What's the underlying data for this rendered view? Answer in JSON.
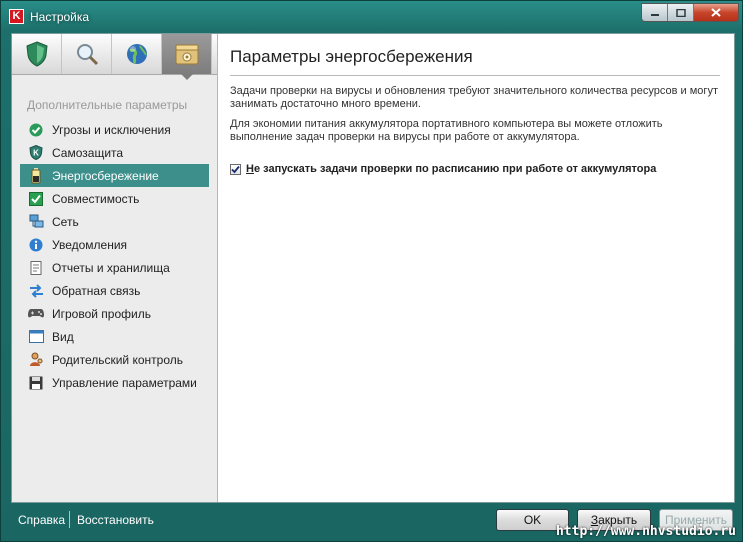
{
  "window": {
    "title": "Настройка"
  },
  "tabs": [
    {
      "icon": "shield-icon",
      "active": false
    },
    {
      "icon": "magnifier-icon",
      "active": false
    },
    {
      "icon": "globe-icon",
      "active": false
    },
    {
      "icon": "settings-box-icon",
      "active": true
    }
  ],
  "sidebar": {
    "heading": "Дополнительные параметры",
    "items": [
      {
        "label": "Угрозы и исключения",
        "icon": "check-circle-icon"
      },
      {
        "label": "Самозащита",
        "icon": "shield-k-icon"
      },
      {
        "label": "Энергосбережение",
        "icon": "battery-icon",
        "active": true
      },
      {
        "label": "Совместимость",
        "icon": "compatibility-icon"
      },
      {
        "label": "Сеть",
        "icon": "network-icon"
      },
      {
        "label": "Уведомления",
        "icon": "info-icon"
      },
      {
        "label": "Отчеты и хранилища",
        "icon": "reports-icon"
      },
      {
        "label": "Обратная связь",
        "icon": "arrows-icon"
      },
      {
        "label": "Игровой профиль",
        "icon": "gamepad-icon"
      },
      {
        "label": "Вид",
        "icon": "window-icon"
      },
      {
        "label": "Родительский контроль",
        "icon": "parental-icon"
      },
      {
        "label": "Управление параметрами",
        "icon": "floppy-icon"
      }
    ]
  },
  "main": {
    "title": "Параметры энергосбережения",
    "para1": "Задачи проверки на вирусы и обновления требуют значительного количества ресурсов и могут занимать достаточно много времени.",
    "para2": "Для экономии питания аккумулятора портативного компьютера вы можете отложить выполнение задач проверки на вирусы при работе от аккумулятора.",
    "checkbox_first": "Н",
    "checkbox_rest": "е запускать задачи проверки по расписанию при работе от аккумулятора",
    "checkbox_checked": true
  },
  "footer": {
    "help": "Справка",
    "restore": "Восстановить",
    "ok": "OK",
    "close_first": "З",
    "close_rest": "акрыть",
    "apply": "Применить"
  },
  "watermark": "http://www.nhvstudio.ru",
  "colors": {
    "accent": "#3c8f8a",
    "frame": "#1d6f6b"
  }
}
